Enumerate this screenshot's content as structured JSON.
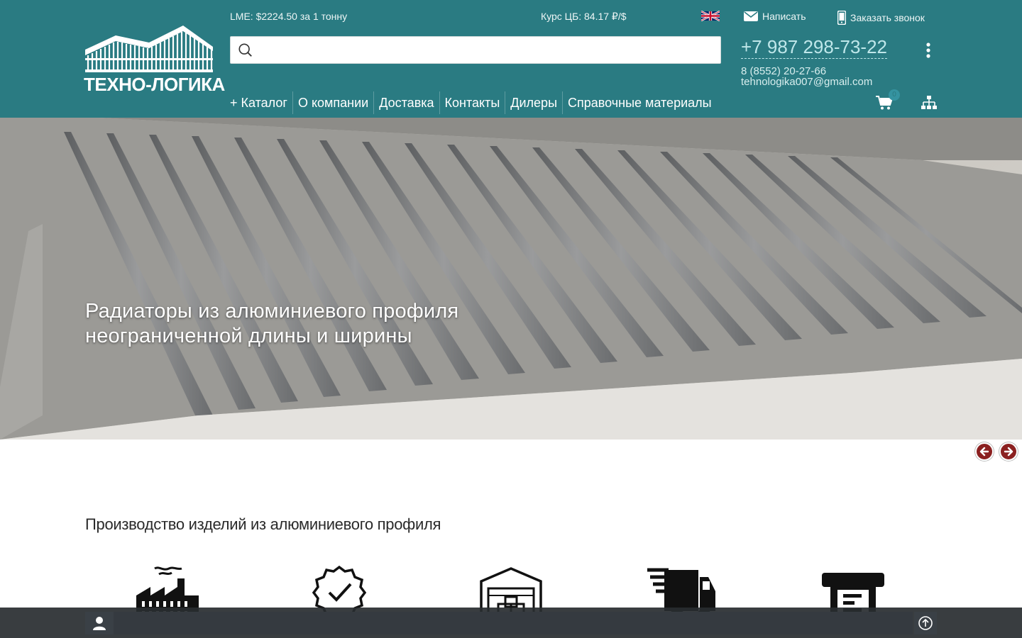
{
  "header": {
    "logo_text": "ТЕХНО-ЛОГИКА",
    "lme": "LME: $2224.50 за 1 тонну",
    "rate": "Курс ЦБ: 84.17 ₽/$",
    "search": {
      "placeholder": "",
      "value": ""
    },
    "nav": [
      "+ Каталог",
      "О компании",
      "Доставка",
      "Контакты",
      "Дилеры",
      "Справочные материалы"
    ],
    "write_label": "Написать",
    "call_label": "Заказать звонок",
    "phone_main": "+7 987 298-73-22",
    "phone_2": "8 (8552) 20-27-66",
    "email": "tehnologika007@gmail.com",
    "cart_count": "0"
  },
  "hero": {
    "title_line1": "Радиаторы из алюминиевого профиля",
    "title_line2": "неограниченной длины и ширины"
  },
  "section": {
    "title": "Производство изделий из алюминиевого профиля",
    "features": [
      "factory-icon",
      "quality-badge-icon",
      "warehouse-icon",
      "delivery-truck-icon",
      "machine-icon"
    ]
  },
  "colors": {
    "header_bg": "#2a7b82",
    "phone_color": "#bfe7ea",
    "slider_arrow": "#8b2020",
    "bottom_bar": "#282c30"
  }
}
